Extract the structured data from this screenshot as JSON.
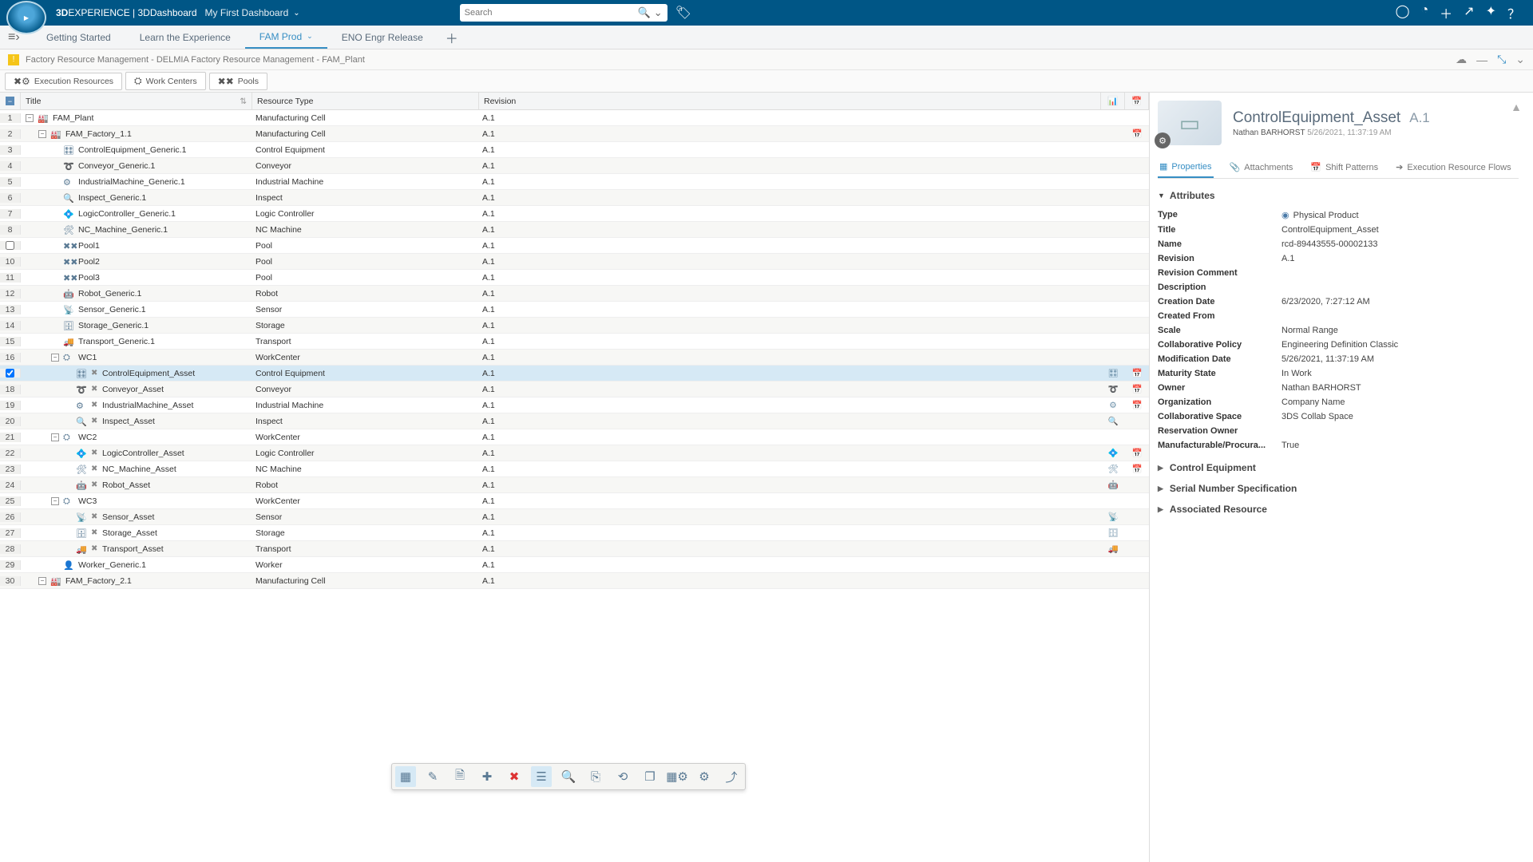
{
  "header": {
    "brand_prefix": "3D",
    "brand_mid": "EXPERIENCE",
    "brand_sep": " | ",
    "brand_suffix": "3DDashboard",
    "dashboard_name": "My First Dashboard",
    "search_placeholder": "Search"
  },
  "tabs": [
    {
      "label": "Getting Started",
      "active": false
    },
    {
      "label": "Learn the Experience",
      "active": false
    },
    {
      "label": "FAM Prod",
      "active": true,
      "dropdown": true
    },
    {
      "label": "ENO Engr Release",
      "active": false
    }
  ],
  "breadcrumb": "Factory Resource Management - DELMIA Factory Resource Management - FAM_Plant",
  "seg_buttons": [
    {
      "icon": "✖⚙",
      "label": "Execution Resources"
    },
    {
      "icon": "⛭",
      "label": "Work Centers"
    },
    {
      "icon": "✖✖",
      "label": "Pools"
    }
  ],
  "columns": {
    "title": "Title",
    "type": "Resource Type",
    "rev": "Revision"
  },
  "rows": [
    {
      "n": "1",
      "indent": 0,
      "exp": "-",
      "icon": "🏭",
      "title": "FAM_Plant",
      "type": "Manufacturing Cell",
      "rev": "A.1"
    },
    {
      "n": "2",
      "indent": 1,
      "exp": "-",
      "icon": "🏭",
      "title": "FAM_Factory_1.1",
      "type": "Manufacturing Cell",
      "rev": "A.1",
      "rowic2": "📅"
    },
    {
      "n": "3",
      "indent": 2,
      "icon": "🎛",
      "title": "ControlEquipment_Generic.1",
      "type": "Control Equipment",
      "rev": "A.1"
    },
    {
      "n": "4",
      "indent": 2,
      "icon": "➰",
      "title": "Conveyor_Generic.1",
      "type": "Conveyor",
      "rev": "A.1"
    },
    {
      "n": "5",
      "indent": 2,
      "icon": "⚙",
      "title": "IndustrialMachine_Generic.1",
      "type": "Industrial Machine",
      "rev": "A.1"
    },
    {
      "n": "6",
      "indent": 2,
      "icon": "🔍",
      "title": "Inspect_Generic.1",
      "type": "Inspect",
      "rev": "A.1"
    },
    {
      "n": "7",
      "indent": 2,
      "icon": "💠",
      "title": "LogicController_Generic.1",
      "type": "Logic Controller",
      "rev": "A.1"
    },
    {
      "n": "8",
      "indent": 2,
      "icon": "🛠",
      "title": "NC_Machine_Generic.1",
      "type": "NC Machine",
      "rev": "A.1"
    },
    {
      "n": "9",
      "indent": 2,
      "icon": "✖✖",
      "title": "Pool1",
      "type": "Pool",
      "rev": "A.1",
      "checkbox": true
    },
    {
      "n": "10",
      "indent": 2,
      "icon": "✖✖",
      "title": "Pool2",
      "type": "Pool",
      "rev": "A.1"
    },
    {
      "n": "11",
      "indent": 2,
      "icon": "✖✖",
      "title": "Pool3",
      "type": "Pool",
      "rev": "A.1"
    },
    {
      "n": "12",
      "indent": 2,
      "icon": "🤖",
      "title": "Robot_Generic.1",
      "type": "Robot",
      "rev": "A.1"
    },
    {
      "n": "13",
      "indent": 2,
      "icon": "📡",
      "title": "Sensor_Generic.1",
      "type": "Sensor",
      "rev": "A.1"
    },
    {
      "n": "14",
      "indent": 2,
      "icon": "🗄",
      "title": "Storage_Generic.1",
      "type": "Storage",
      "rev": "A.1"
    },
    {
      "n": "15",
      "indent": 2,
      "icon": "🚚",
      "title": "Transport_Generic.1",
      "type": "Transport",
      "rev": "A.1"
    },
    {
      "n": "16",
      "indent": 2,
      "exp": "-",
      "icon": "⛭",
      "title": "WC1",
      "type": "WorkCenter",
      "rev": "A.1"
    },
    {
      "n": "",
      "indent": 3,
      "icon": "🎛",
      "xicon": "✖",
      "title": "ControlEquipment_Asset",
      "type": "Control Equipment",
      "rev": "A.1",
      "selected": true,
      "rowic1": "🎛",
      "rowic2": "📅",
      "checked": true
    },
    {
      "n": "18",
      "indent": 3,
      "icon": "➰",
      "xicon": "✖",
      "title": "Conveyor_Asset",
      "type": "Conveyor",
      "rev": "A.1",
      "rowic1": "➰",
      "rowic2": "📅"
    },
    {
      "n": "19",
      "indent": 3,
      "icon": "⚙",
      "xicon": "✖",
      "title": "IndustrialMachine_Asset",
      "type": "Industrial Machine",
      "rev": "A.1",
      "rowic1": "⚙",
      "rowic2": "📅"
    },
    {
      "n": "20",
      "indent": 3,
      "icon": "🔍",
      "xicon": "✖",
      "title": "Inspect_Asset",
      "type": "Inspect",
      "rev": "A.1",
      "rowic1": "🔍"
    },
    {
      "n": "21",
      "indent": 2,
      "exp": "-",
      "icon": "⛭",
      "title": "WC2",
      "type": "WorkCenter",
      "rev": "A.1"
    },
    {
      "n": "22",
      "indent": 3,
      "icon": "💠",
      "xicon": "✖",
      "title": "LogicController_Asset",
      "type": "Logic Controller",
      "rev": "A.1",
      "rowic1": "💠",
      "rowic2": "📅"
    },
    {
      "n": "23",
      "indent": 3,
      "icon": "🛠",
      "xicon": "✖",
      "title": "NC_Machine_Asset",
      "type": "NC Machine",
      "rev": "A.1",
      "rowic1": "🛠",
      "rowic2": "📅"
    },
    {
      "n": "24",
      "indent": 3,
      "icon": "🤖",
      "xicon": "✖",
      "title": "Robot_Asset",
      "type": "Robot",
      "rev": "A.1",
      "rowic1": "🤖"
    },
    {
      "n": "25",
      "indent": 2,
      "exp": "-",
      "icon": "⛭",
      "title": "WC3",
      "type": "WorkCenter",
      "rev": "A.1"
    },
    {
      "n": "26",
      "indent": 3,
      "icon": "📡",
      "xicon": "✖",
      "title": "Sensor_Asset",
      "type": "Sensor",
      "rev": "A.1",
      "rowic1": "📡"
    },
    {
      "n": "27",
      "indent": 3,
      "icon": "🗄",
      "xicon": "✖",
      "title": "Storage_Asset",
      "type": "Storage",
      "rev": "A.1",
      "rowic1": "🗄"
    },
    {
      "n": "28",
      "indent": 3,
      "icon": "🚚",
      "xicon": "✖",
      "title": "Transport_Asset",
      "type": "Transport",
      "rev": "A.1",
      "rowic1": "🚚"
    },
    {
      "n": "29",
      "indent": 2,
      "icon": "👤",
      "title": "Worker_Generic.1",
      "type": "Worker",
      "rev": "A.1"
    },
    {
      "n": "30",
      "indent": 1,
      "exp": "-",
      "icon": "🏭",
      "title": "FAM_Factory_2.1",
      "type": "Manufacturing Cell",
      "rev": "A.1"
    }
  ],
  "side": {
    "title": "ControlEquipment_Asset",
    "rev": "A.1",
    "author": "Nathan BARHORST",
    "timestamp": "5/26/2021, 11:37:19 AM",
    "tabs": [
      {
        "icon": "▦",
        "label": "Properties",
        "active": true
      },
      {
        "icon": "📎",
        "label": "Attachments"
      },
      {
        "icon": "📅",
        "label": "Shift Patterns"
      },
      {
        "icon": "➔",
        "label": "Execution Resource Flows"
      }
    ],
    "section_attributes": "Attributes",
    "attrs": [
      {
        "k": "Type",
        "v": "Physical Product",
        "icon": "◉"
      },
      {
        "k": "Title",
        "v": "ControlEquipment_Asset"
      },
      {
        "k": "Name",
        "v": "rcd-89443555-00002133"
      },
      {
        "k": "Revision",
        "v": "A.1"
      },
      {
        "k": "Revision Comment",
        "v": ""
      },
      {
        "k": "Description",
        "v": ""
      },
      {
        "k": "Creation Date",
        "v": "6/23/2020, 7:27:12 AM"
      },
      {
        "k": "Created From",
        "v": ""
      },
      {
        "k": "Scale",
        "v": "Normal Range"
      },
      {
        "k": "Collaborative Policy",
        "v": "Engineering Definition Classic"
      },
      {
        "k": "Modification Date",
        "v": "5/26/2021, 11:37:19 AM"
      },
      {
        "k": "Maturity State",
        "v": "In Work"
      },
      {
        "k": "Owner",
        "v": "Nathan BARHORST"
      },
      {
        "k": "Organization",
        "v": "Company Name"
      },
      {
        "k": "Collaborative Space",
        "v": "3DS Collab Space"
      },
      {
        "k": "Reservation Owner",
        "v": ""
      },
      {
        "k": "Manufacturable/Procura...",
        "v": "True"
      }
    ],
    "collapsed": [
      "Control Equipment",
      "Serial Number Specification",
      "Associated Resource"
    ]
  }
}
